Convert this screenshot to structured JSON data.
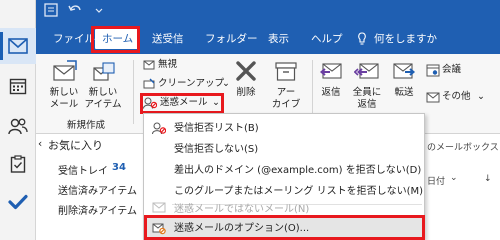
{
  "leftnav": {
    "items": [
      {
        "name": "mail-icon",
        "active": true
      },
      {
        "name": "calendar-icon",
        "active": false
      },
      {
        "name": "people-icon",
        "active": false
      },
      {
        "name": "tasks-icon",
        "active": false
      },
      {
        "name": "todo-check-icon",
        "active": false
      }
    ]
  },
  "titlebar": {
    "icons": [
      "app-icon",
      "undo-icon",
      "more-icon"
    ]
  },
  "tabs": {
    "file": "ファイル",
    "home": "ホーム",
    "sendreceive": "送受信",
    "folder": "フォルダー",
    "view": "表示",
    "help": "ヘルプ",
    "tellme": "何をしますか"
  },
  "ribbon": {
    "new_mail": [
      "新しい",
      "メール"
    ],
    "new_items": [
      "新しい",
      "アイテム"
    ],
    "group_new": "新規作成",
    "ignore": "無視",
    "cleanup": "クリーンアップ",
    "junk": "迷惑メール",
    "delete": "削除",
    "archive": [
      "アー",
      "カイブ"
    ],
    "reply": "返信",
    "reply_all": [
      "全員に",
      "返信"
    ],
    "forward": "転送",
    "meeting": "会議",
    "more": "その他"
  },
  "folders": {
    "favorites": "お気に入り",
    "inbox": "受信トレイ",
    "inbox_count": "34",
    "sent": "送信済みアイテム",
    "deleted": "削除済みアイテム"
  },
  "background": {
    "mailbox_text": "のメールボックス",
    "date_text": "日付"
  },
  "menu": {
    "items": [
      {
        "label": "受信拒否リスト(B)",
        "disabled": false
      },
      {
        "label": "受信拒否しない(S)",
        "disabled": false
      },
      {
        "label": "差出人のドメイン (@example.com) を拒否しない(D)",
        "disabled": false
      },
      {
        "label": "このグループまたはメーリング リストを拒否しない(M)",
        "disabled": false
      },
      {
        "label": "迷惑メールではないメール(N)",
        "disabled": true
      },
      {
        "label": "迷惑メールのオプション(O)...",
        "disabled": false
      }
    ]
  },
  "colors": {
    "accent": "#1f5fb2",
    "highlight": "#e8191e"
  }
}
